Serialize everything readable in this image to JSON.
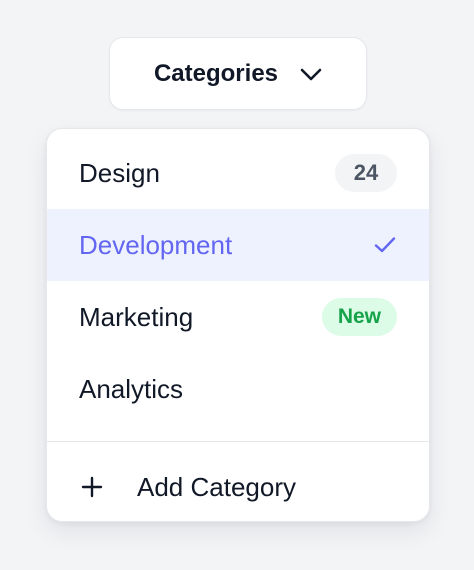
{
  "dropdown": {
    "trigger_label": "Categories",
    "trigger_icon": "chevron-down-icon",
    "items": [
      {
        "label": "Design",
        "badge": "24",
        "selected": false
      },
      {
        "label": "Development",
        "badge": "",
        "selected": true
      },
      {
        "label": "Marketing",
        "badge": "New",
        "selected": false
      },
      {
        "label": "Analytics",
        "badge": "",
        "selected": false
      }
    ],
    "add_item": {
      "label": "Add Category",
      "icon": "plus-icon"
    },
    "colors": {
      "accent": "#6366f1",
      "selected_bg": "#eef2ff",
      "new_badge_bg": "#dcfce7",
      "new_badge_text": "#16a34a",
      "count_badge_bg": "#f3f4f6",
      "text": "#111827"
    }
  }
}
